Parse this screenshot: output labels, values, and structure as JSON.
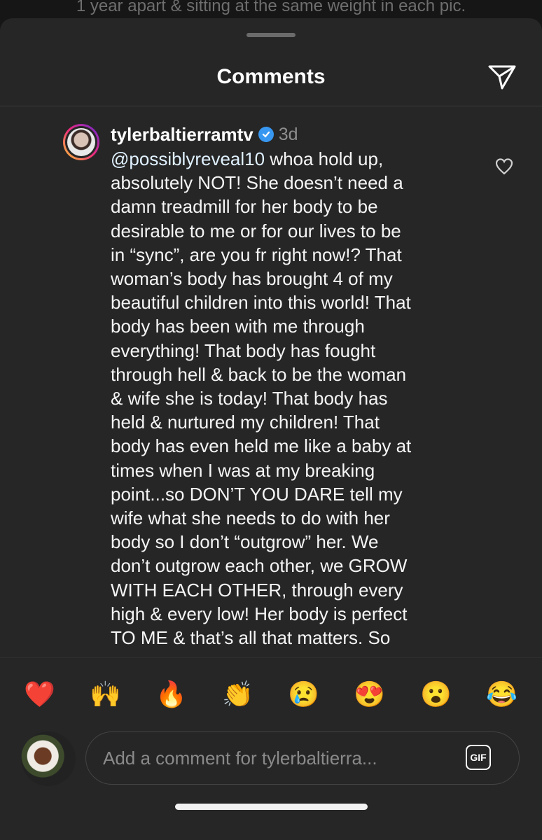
{
  "background_caption": "1 year apart & sitting at the same weight in each pic.",
  "header": {
    "title": "Comments",
    "share_icon": "paper-plane-icon"
  },
  "comment": {
    "username": "tylerbaltierramtv",
    "verified": true,
    "time": "3d",
    "mention": "@possiblyreveal10",
    "text": " whoa hold up,\nabsolutely NOT! She doesn’t need a\ndamn treadmill for her body to be\ndesirable to me or for our lives to be\nin “sync”, are you fr right now!? That\nwoman’s body has brought 4 of my\nbeautiful children into this world! That\nbody has been with me through\neverything! That body has fought\nthrough hell & back to be the woman\n& wife she is today! That body has\nheld & nurtured my children! That\nbody has even held me like a baby at\ntimes when I was at my breaking\npoint...so DON’T YOU DARE tell my\nwife what she needs to do with her\nbody so I don’t “outgrow” her. We\ndon’t outgrow each other, we GROW\nWITH EACH OTHER, through every\nhigh & every low! Her body is perfect\nTO ME & that’s all that matters. So",
    "like_icon": "heart-outline-icon"
  },
  "reactions": [
    "❤️",
    "🙌",
    "🔥",
    "👏",
    "😢",
    "😍",
    "😮",
    "😂"
  ],
  "composer": {
    "placeholder": "Add a comment for tylerbaltierra...",
    "gif_label": "GIF"
  },
  "colors": {
    "background": "#262626",
    "verified": "#3897f0",
    "mention": "#e0f1ff"
  }
}
